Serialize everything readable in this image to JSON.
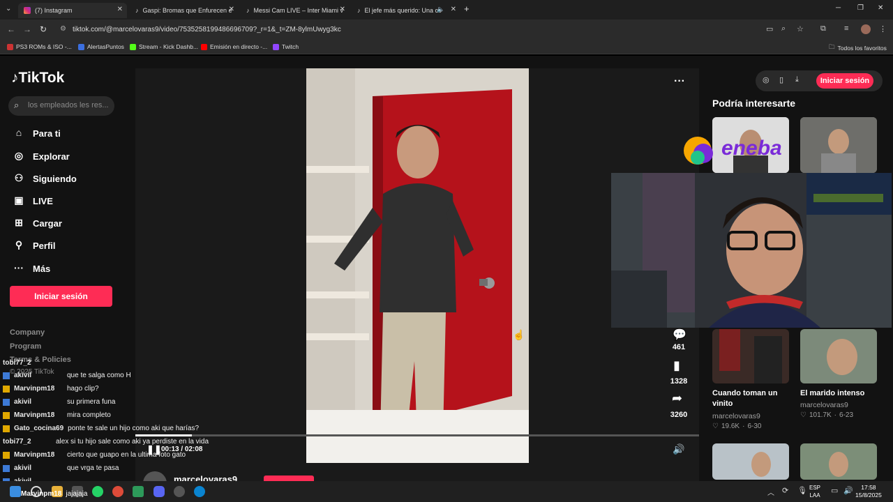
{
  "browser": {
    "tabs": [
      {
        "title": "(7) Instagram"
      },
      {
        "title": "Gaspi: Bromas que Enfurecen e"
      },
      {
        "title": "Messi Cam LIVE – Inter Miami v"
      },
      {
        "title": "El jefe más querido: Una co"
      }
    ],
    "new_tab": "+",
    "url": "tiktok.com/@marcelovaras9/video/7535258199486696709?_r=1&_t=ZM-8ylmUwyg3kc",
    "bookmarks": [
      "PS3 ROMs & ISO -...",
      "AlertasPuntos",
      "Stream - Kick Dashb...",
      "Emisión en directo -...",
      "Twitch"
    ],
    "all_bookmarks": "Todos los favoritos"
  },
  "tiktok": {
    "logo": "TikTok",
    "search_placeholder": "los empleados les res...",
    "nav": [
      {
        "label": "Para ti",
        "icon": "home-icon"
      },
      {
        "label": "Explorar",
        "icon": "compass-icon"
      },
      {
        "label": "Siguiendo",
        "icon": "people-icon"
      },
      {
        "label": "LIVE",
        "icon": "live-icon"
      },
      {
        "label": "Cargar",
        "icon": "upload-icon"
      },
      {
        "label": "Perfil",
        "icon": "profile-icon"
      },
      {
        "label": "Más",
        "icon": "more-icon"
      }
    ],
    "login_button": "Iniciar sesión",
    "footer": [
      "Company",
      "Program",
      "Terms & Policies",
      "© 2025 TikTok"
    ],
    "video": {
      "comments_count": "461",
      "saves_count": "1328",
      "shares_count": "3260",
      "time": "00:13 / 02:08",
      "progress": 0.1,
      "author": "marcelovaras9"
    },
    "right": {
      "login_button": "Iniciar sesión",
      "title": "Podría interesarte",
      "cards": [
        {
          "title": "Cuando toman un vinito",
          "user": "marcelovaras9",
          "likes": "19.6K",
          "date": "6-30"
        },
        {
          "title": "El marido intenso",
          "user": "marcelovaras9",
          "likes": "101.7K",
          "date": "6-23"
        }
      ],
      "sponsor": "eneba"
    }
  },
  "chat": [
    {
      "user": "tobi77_2",
      "msg": "",
      "badge": "none"
    },
    {
      "user": "akivil",
      "msg": "que te salga como H",
      "badge": "blue"
    },
    {
      "user": "Marvinpm18",
      "msg": "hago clip?",
      "badge": "gold"
    },
    {
      "user": "akivil",
      "msg": "su primera funa",
      "badge": "blue"
    },
    {
      "user": "Marvinpm18",
      "msg": "mira completo",
      "badge": "gold"
    },
    {
      "user": "Gato_cocina69",
      "msg": "ponte te sale un hijo como aki que harías?",
      "badge": "gold"
    },
    {
      "user": "tobi77_2",
      "msg": "alex si tu hijo sale como aki ya perdiste en la vida",
      "badge": "none"
    },
    {
      "user": "Marvinpm18",
      "msg": "cierto que guapo en la ultima foto gato",
      "badge": "gold"
    },
    {
      "user": "akivil",
      "msg": "que vrga te pasa",
      "badge": "blue"
    },
    {
      "user": "akivil",
      "msg": "",
      "badge": "blue"
    },
    {
      "user": "Marvinpm18",
      "msg": "jajajaja",
      "badge": "gold"
    }
  ],
  "taskbar": {
    "lang": "ESP",
    "lang2": "LAA",
    "time": "17:58",
    "date": "15/8/2025"
  },
  "colors": {
    "accent": "#fe2c55",
    "page_bg": "#121212"
  }
}
